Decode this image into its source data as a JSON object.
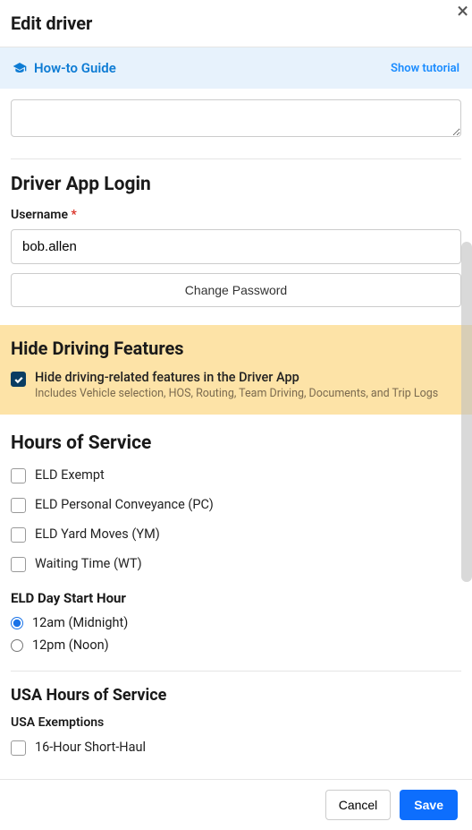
{
  "header": {
    "title": "Edit driver"
  },
  "banner": {
    "title": "How-to Guide",
    "link": "Show tutorial"
  },
  "login_section": {
    "title": "Driver App Login",
    "username_label": "Username",
    "username_value": "bob.allen",
    "change_password": "Change Password"
  },
  "hide_section": {
    "title": "Hide Driving Features",
    "check_label": "Hide driving-related features in the Driver App",
    "check_sublabel": "Includes Vehicle selection, HOS, Routing, Team Driving, Documents, and Trip Logs"
  },
  "hos_section": {
    "title": "Hours of Service",
    "options": {
      "eld_exempt": "ELD Exempt",
      "eld_pc": "ELD Personal Conveyance (PC)",
      "eld_ym": "ELD Yard Moves (YM)",
      "waiting_time": "Waiting Time (WT)"
    },
    "day_start_heading": "ELD Day Start Hour",
    "radio_12am": "12am (Midnight)",
    "radio_12pm": "12pm (Noon)"
  },
  "usa_section": {
    "title": "USA Hours of Service",
    "exemptions_label": "USA Exemptions",
    "short_haul": "16-Hour Short-Haul"
  },
  "footer": {
    "cancel": "Cancel",
    "save": "Save"
  }
}
